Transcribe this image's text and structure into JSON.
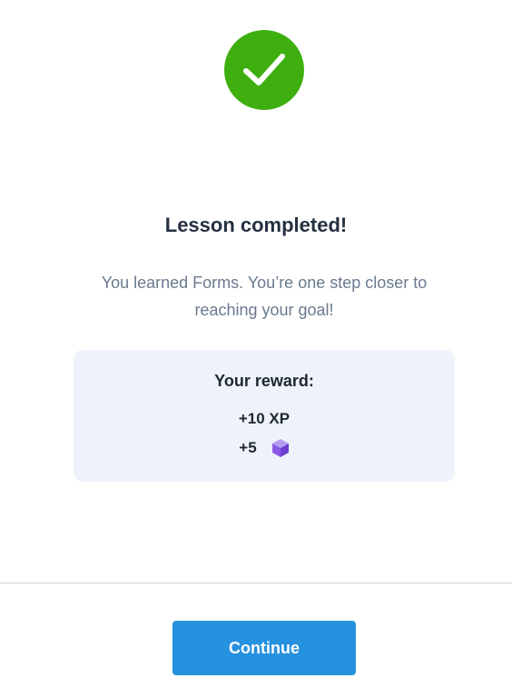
{
  "success_icon": {
    "name": "checkmark-icon",
    "color": "#3eaf0f"
  },
  "lesson": {
    "title": "Lesson completed!",
    "message_line1": "You learned Forms. You’re one step closer to",
    "message_line2": "reaching your goal!"
  },
  "reward": {
    "title": "Your reward:",
    "xp": "+10 XP",
    "gems": "+5",
    "gem_icon": "gem-icon",
    "card_color": "#eef3fb"
  },
  "footer": {
    "continue_label": "Continue",
    "button_color": "#2691de"
  }
}
